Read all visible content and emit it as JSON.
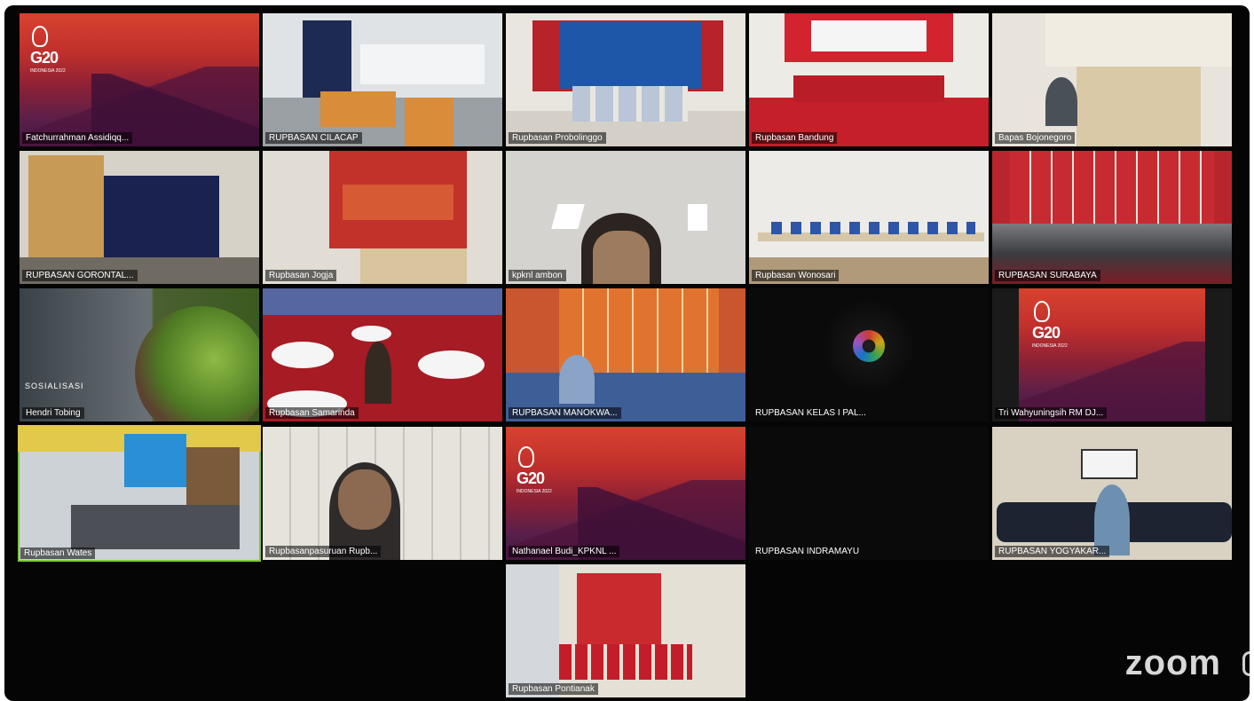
{
  "app": {
    "brand": "zoom"
  },
  "tiles": [
    {
      "name": "Fatchurrahman Assidiqq...",
      "type": "g20",
      "logo": "G20",
      "logo_sub": "INDONESIA 2022"
    },
    {
      "name": "RUPBASAN CILACAP",
      "type": "video"
    },
    {
      "name": "Rupbasan Probolinggo",
      "type": "video"
    },
    {
      "name": "Rupbasan Bandung",
      "type": "video"
    },
    {
      "name": "Bapas Bojonegoro",
      "type": "video"
    },
    {
      "name": "RUPBASAN GORONTAL...",
      "type": "video"
    },
    {
      "name": "Rupbasan Jogja",
      "type": "video"
    },
    {
      "name": "kpknl ambon",
      "type": "video"
    },
    {
      "name": "Rupbasan Wonosari",
      "type": "video"
    },
    {
      "name": "RUPBASAN SURABAYA",
      "type": "video"
    },
    {
      "name": "Hendri Tobing",
      "type": "video",
      "overlay_text": "SOSIALISASI"
    },
    {
      "name": "Rupbasan Samarinda",
      "type": "video"
    },
    {
      "name": "RUPBASAN MANOKWA...",
      "type": "video"
    },
    {
      "name": "RUPBASAN KELAS I PAL...",
      "type": "avatar"
    },
    {
      "name": "Tri Wahyuningsih RM DJ...",
      "type": "g20",
      "logo": "G20",
      "logo_sub": "INDONESIA 2022"
    },
    {
      "name": "Rupbasan Wates",
      "type": "video",
      "active": true
    },
    {
      "name": "Rupbasanpasuruan Rupb...",
      "type": "video"
    },
    {
      "name": "Nathanael Budi_KPKNL ...",
      "type": "g20",
      "logo": "G20",
      "logo_sub": "INDONESIA 2022"
    },
    {
      "name": "RUPBASAN INDRAMAYU",
      "type": "off"
    },
    {
      "name": "RUPBASAN YOGYAKAR...",
      "type": "video"
    },
    {
      "name": "Rupbasan Pontianak",
      "type": "video"
    }
  ]
}
